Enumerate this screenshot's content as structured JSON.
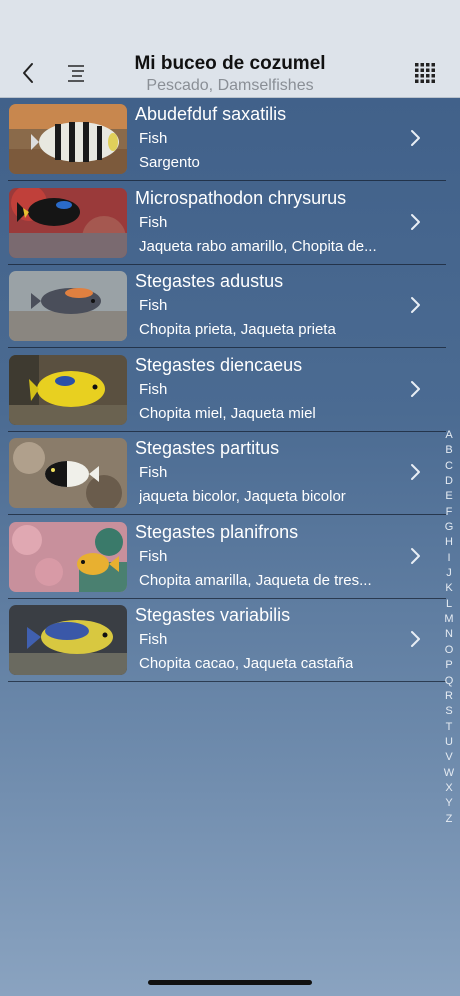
{
  "header": {
    "title": "Mi buceo de cozumel",
    "subtitle": "Pescado, Damselfishes",
    "back_icon": "chevron-left-icon",
    "menu_icon": "list-icon",
    "grid_icon": "grid-icon"
  },
  "items": [
    {
      "name": "Abudefduf saxatilis",
      "type": "Fish",
      "common": "Sargento"
    },
    {
      "name": "Microspathodon chrysurus",
      "type": "Fish",
      "common": "Jaqueta rabo amarillo, Chopita de..."
    },
    {
      "name": "Stegastes adustus",
      "type": "Fish",
      "common": "Chopita prieta, Jaqueta prieta"
    },
    {
      "name": "Stegastes diencaeus",
      "type": "Fish",
      "common": "Chopita miel, Jaqueta miel"
    },
    {
      "name": "Stegastes partitus",
      "type": "Fish",
      "common": "jaqueta bicolor, Jaqueta bicolor"
    },
    {
      "name": "Stegastes planifrons",
      "type": "Fish",
      "common": "Chopita amarilla, Jaqueta de tres..."
    },
    {
      "name": "Stegastes variabilis",
      "type": "Fish",
      "common": "Chopita cacao, Jaqueta castaña"
    }
  ],
  "index_letters": [
    "A",
    "B",
    "C",
    "D",
    "E",
    "F",
    "G",
    "H",
    "I",
    "J",
    "K",
    "L",
    "M",
    "N",
    "O",
    "P",
    "Q",
    "R",
    "S",
    "T",
    "U",
    "V",
    "W",
    "X",
    "Y",
    "Z"
  ],
  "colors": {
    "header_bg": "#dde3ea",
    "list_bg": "#4a6a90",
    "text": "#ffffff"
  }
}
